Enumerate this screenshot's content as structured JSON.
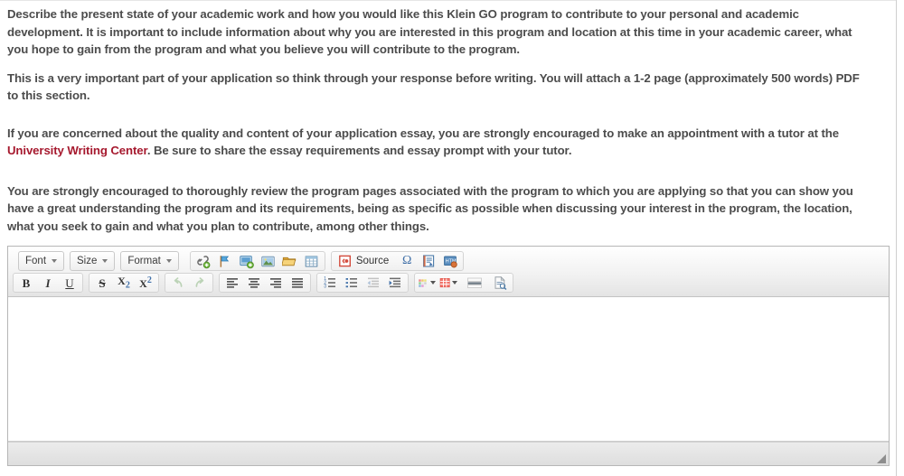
{
  "page": {
    "paragraphs": [
      {
        "id": "p1",
        "text": "Describe the present state of your academic work and how you would like this Klein GO program to contribute to your personal and academic development. It is important to include information about why you are interested in this program and location at this time in your academic career, what you hope to gain from the program and what you believe you will contribute to the program."
      },
      {
        "id": "p2",
        "text": "This is a very important part of your application so think through your response before writing. You will attach a 1-2 page (approximately 500 words) PDF to this section."
      },
      {
        "id": "p4",
        "text": "You are strongly encouraged to thoroughly review the program pages associated with the program to which you are applying so that you can show you have a great understanding the program and its requirements, being as specific as possible when discussing your interest in the program, the location, what you seek to gain and what you plan to contribute, among other things."
      }
    ],
    "paragraph_with_link": {
      "before": "If you are concerned about the quality and content of your application essay, you are strongly encouraged to make an appointment with a tutor at the ",
      "link_text": "University Writing Center",
      "after": ". Be sure to share the essay requirements and essay prompt with your tutor."
    },
    "link_color": "#a6192e",
    "text_color": "#4c4c4c"
  },
  "editor": {
    "name": "rich-text-editor",
    "content": "",
    "placeholder": "",
    "toolbar_row1": {
      "combos": [
        {
          "label": "Font",
          "name": "font-combo"
        },
        {
          "label": "Size",
          "name": "size-combo"
        },
        {
          "label": "Format",
          "name": "format-combo"
        }
      ],
      "insert_group": [
        {
          "name": "link-icon",
          "title": "Link"
        },
        {
          "name": "anchor-icon",
          "title": "Anchor"
        },
        {
          "name": "insert-media-icon",
          "title": "Insert Media"
        },
        {
          "name": "image-icon",
          "title": "Image"
        },
        {
          "name": "file-browser-icon",
          "title": "Browse Server"
        },
        {
          "name": "table-icon",
          "title": "Table"
        }
      ],
      "tools_group": [
        {
          "name": "source-icon",
          "label": "Source",
          "title": "Source"
        },
        {
          "name": "special-character-icon",
          "label": "Ω",
          "title": "Insert Special Character"
        },
        {
          "name": "page-properties-icon",
          "title": "Document Properties"
        },
        {
          "name": "html-snippet-icon",
          "title": "Insert HTML Snippet"
        }
      ]
    },
    "toolbar_row2": {
      "basic_styles": [
        {
          "name": "bold-icon",
          "label": "B",
          "title": "Bold"
        },
        {
          "name": "italic-icon",
          "label": "I",
          "title": "Italic"
        },
        {
          "name": "underline-icon",
          "label": "U",
          "title": "Underline"
        }
      ],
      "extra_styles": [
        {
          "name": "strikethrough-icon",
          "label": "S",
          "title": "Strike Through"
        },
        {
          "name": "subscript-icon",
          "label": "X2",
          "title": "Subscript"
        },
        {
          "name": "superscript-icon",
          "label": "X2",
          "title": "Superscript"
        }
      ],
      "history": [
        {
          "name": "undo-icon",
          "title": "Undo",
          "disabled": true
        },
        {
          "name": "redo-icon",
          "title": "Redo",
          "disabled": true
        }
      ],
      "alignment": [
        {
          "name": "align-left-icon",
          "title": "Align Left"
        },
        {
          "name": "align-center-icon",
          "title": "Center"
        },
        {
          "name": "align-right-icon",
          "title": "Align Right"
        },
        {
          "name": "align-justify-icon",
          "title": "Justify"
        }
      ],
      "lists": [
        {
          "name": "numbered-list-icon",
          "title": "Insert/Remove Numbered List"
        },
        {
          "name": "bulleted-list-icon",
          "title": "Insert/Remove Bulleted List"
        },
        {
          "name": "decrease-indent-icon",
          "title": "Decrease Indent",
          "disabled": true
        },
        {
          "name": "increase-indent-icon",
          "title": "Increase Indent"
        }
      ],
      "colors_and_misc": [
        {
          "name": "text-color-icon",
          "title": "Text Color"
        },
        {
          "name": "background-color-icon",
          "title": "Background Color"
        },
        {
          "name": "horizontal-rule-icon",
          "title": "Insert Horizontal Line"
        },
        {
          "name": "templates-icon",
          "title": "Templates"
        }
      ]
    },
    "footer": {
      "path": "",
      "resize_grip": "resize-grip"
    }
  }
}
